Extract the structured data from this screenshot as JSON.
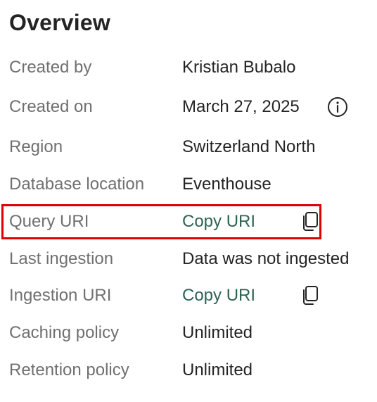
{
  "overview": {
    "title": "Overview",
    "rows": [
      {
        "label": "Created by",
        "value": "Kristian Bubalo"
      },
      {
        "label": "Created on",
        "value": "March 27, 2025",
        "icon": "info-icon"
      },
      {
        "label": "Region",
        "value": "Switzerland North"
      },
      {
        "label": "Database location",
        "value": "Eventhouse"
      },
      {
        "label": "Query URI",
        "value": "Copy URI",
        "icon": "copy-icon"
      },
      {
        "label": "Last ingestion",
        "value": "Data was not ingested"
      },
      {
        "label": "Ingestion URI",
        "value": "Copy URI",
        "icon": "copy-icon"
      },
      {
        "label": "Caching policy",
        "value": "Unlimited"
      },
      {
        "label": "Retention policy",
        "value": "Unlimited"
      }
    ]
  },
  "colors": {
    "link": "#2f6351",
    "label": "#707070",
    "value": "#242424",
    "highlight": "#e00000"
  }
}
